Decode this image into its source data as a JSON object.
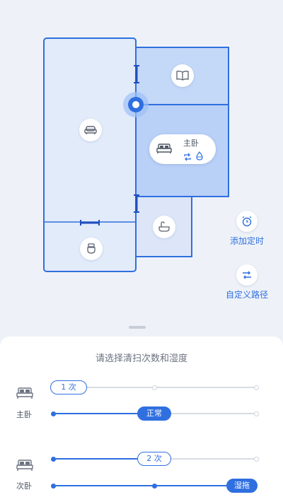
{
  "map": {
    "current_room": {
      "name": "主卧"
    },
    "actions": [
      {
        "label": "添加定时",
        "icon": "alarm-clock-icon"
      },
      {
        "label": "自定义路径",
        "icon": "custom-path-icon"
      }
    ],
    "colors": {
      "accent": "#2f6fe0",
      "room_fill": "#dbe7fb",
      "selected_fill": "#b9d0f7"
    }
  },
  "sheet": {
    "title": "请选择清扫次数和湿度",
    "rooms": [
      {
        "label": "主卧",
        "passes_label": "1 次",
        "passes_value": 1,
        "moisture_label": "正常",
        "moisture_level": 2
      },
      {
        "label": "次卧",
        "passes_label": "2 次",
        "passes_value": 2,
        "moisture_label": "湿拖",
        "moisture_level": 3
      }
    ]
  }
}
